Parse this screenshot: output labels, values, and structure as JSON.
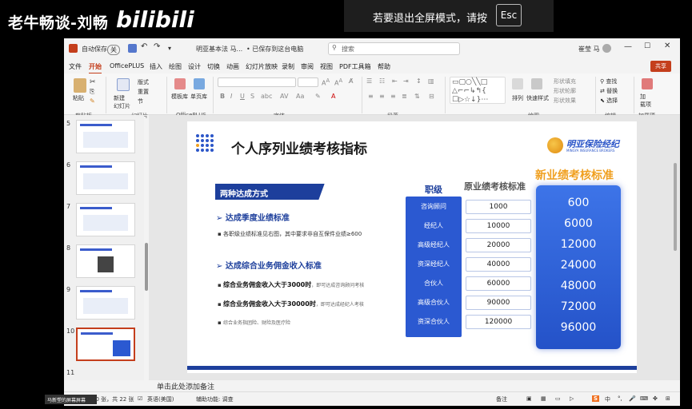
{
  "overlay": {
    "channel_name": "老牛畅谈-刘畅",
    "platform_logo": "bilibili",
    "esc_message": "若要退出全屏模式，请按",
    "esc_key": "Esc"
  },
  "titlebar": {
    "autosave_label": "自动保存",
    "autosave_state": "关",
    "doc_name": "明亚基本法 马...",
    "saved_status": "• 已保存到这台电脑",
    "search_placeholder": "搜索",
    "user_name": "崔莹 马"
  },
  "menu": {
    "tabs": [
      "文件",
      "开始",
      "OfficePLUS",
      "插入",
      "绘图",
      "设计",
      "切换",
      "动画",
      "幻灯片放映",
      "录制",
      "审阅",
      "视图",
      "PDF工具箱",
      "帮助"
    ],
    "active_tab": "开始",
    "share_label": "共享"
  },
  "ribbon": {
    "groups": [
      "剪贴板",
      "幻灯片",
      "OfficePLUS",
      "字体",
      "段落",
      "绘图",
      "编辑",
      "加载项"
    ],
    "paste_label": "粘贴",
    "new_slide_label": "新建\n幻灯片",
    "layout_label": "版式",
    "reset_label": "重置",
    "section_label": "节",
    "template_label": "模板库",
    "single_page_label": "单页库",
    "arrange_label": "排列",
    "quick_styles_label": "快速样式",
    "shape_fill_label": "形状填充",
    "shape_outline_label": "形状轮廓",
    "shape_effects_label": "形状效果",
    "find_label": "查找",
    "replace_label": "替换",
    "select_label": "选择",
    "addins_label": "加\n载项"
  },
  "thumbnails": [
    {
      "num": "5"
    },
    {
      "num": "6"
    },
    {
      "num": "7"
    },
    {
      "num": "8"
    },
    {
      "num": "9"
    },
    {
      "num": "10",
      "active": true
    },
    {
      "num": "11"
    }
  ],
  "slide": {
    "title": "个人序列业绩考核指标",
    "logo_text": "明亚保险经纪",
    "logo_sub": "MINGYA INSURANCE BROKERS",
    "section_bar": "两种达成方式",
    "section1_head": "➢ 达成季度业绩标准",
    "section1_bullet": "各职级业绩标准见右图，其中要求非自互保件业绩≥600",
    "section2_head": "➢ 达成综合业务佣金收入标准",
    "bullets": [
      {
        "bold": "综合业务佣金收入大于3000时",
        "rest": "，即可达成咨询顾问考核"
      },
      {
        "bold": "综合业务佣金收入大于30000时",
        "rest": "，即可达成经纪人考核"
      },
      {
        "bold": "",
        "rest": "综合业务指团险、财险及医疗险"
      }
    ],
    "table": {
      "col_rank": "职级",
      "col_old": "原业绩考核标准",
      "col_new": "新业绩考核标准",
      "ranks": [
        "咨询顾问",
        "经纪人",
        "高级经纪人",
        "资深经纪人",
        "合伙人",
        "高级合伙人",
        "资深合伙人"
      ],
      "old_values": [
        "1000",
        "10000",
        "20000",
        "40000",
        "60000",
        "90000",
        "120000"
      ],
      "new_values": [
        "600",
        "6000",
        "12000",
        "24000",
        "48000",
        "72000",
        "96000"
      ]
    }
  },
  "notes_placeholder": "单击此处添加备注",
  "status": {
    "slide_info": "10 张，共 22 张",
    "language": "英语(美国)",
    "accessibility": "辅助功能: 调查",
    "notes_btn": "备注"
  },
  "tooltip": "马新塑的屏幕屏幕"
}
